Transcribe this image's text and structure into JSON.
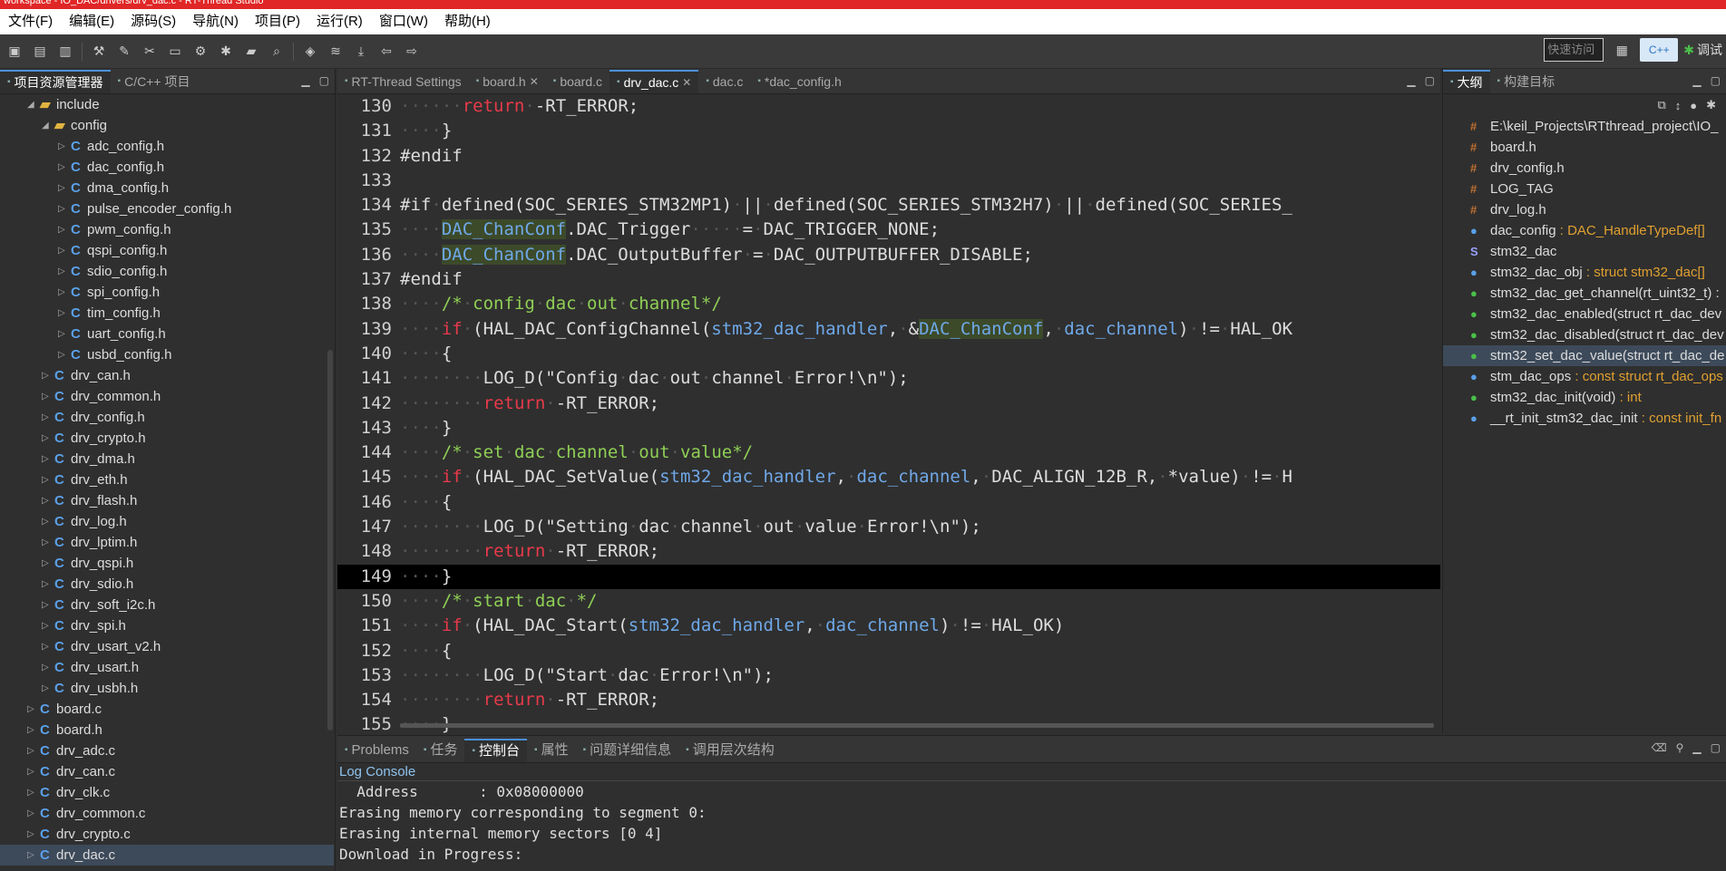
{
  "window": {
    "title": "workspace - IO_DAC/drivers/drv_dac.c - RT-Thread Studio"
  },
  "menu": [
    "文件(F)",
    "编辑(E)",
    "源码(S)",
    "导航(N)",
    "项目(P)",
    "运行(R)",
    "窗口(W)",
    "帮助(H)"
  ],
  "toolbar": {
    "quick_access": "快速访问",
    "perspective_c": "C++",
    "debug_label": "调试"
  },
  "project_panel": {
    "tabs": [
      {
        "label": "项目资源管理器",
        "active": true
      },
      {
        "label": "C/C++ 项目",
        "active": false
      }
    ],
    "tree": [
      {
        "label": "include",
        "kind": "folder",
        "depth": 2,
        "expanded": true
      },
      {
        "label": "config",
        "kind": "folder",
        "depth": 3,
        "expanded": true
      },
      {
        "label": "adc_config.h",
        "kind": "c",
        "depth": 4
      },
      {
        "label": "dac_config.h",
        "kind": "c",
        "depth": 4
      },
      {
        "label": "dma_config.h",
        "kind": "c",
        "depth": 4
      },
      {
        "label": "pulse_encoder_config.h",
        "kind": "c",
        "depth": 4
      },
      {
        "label": "pwm_config.h",
        "kind": "c",
        "depth": 4
      },
      {
        "label": "qspi_config.h",
        "kind": "c",
        "depth": 4
      },
      {
        "label": "sdio_config.h",
        "kind": "c",
        "depth": 4
      },
      {
        "label": "spi_config.h",
        "kind": "c",
        "depth": 4
      },
      {
        "label": "tim_config.h",
        "kind": "c",
        "depth": 4
      },
      {
        "label": "uart_config.h",
        "kind": "c",
        "depth": 4
      },
      {
        "label": "usbd_config.h",
        "kind": "c",
        "depth": 4
      },
      {
        "label": "drv_can.h",
        "kind": "c",
        "depth": 3
      },
      {
        "label": "drv_common.h",
        "kind": "c",
        "depth": 3
      },
      {
        "label": "drv_config.h",
        "kind": "c",
        "depth": 3
      },
      {
        "label": "drv_crypto.h",
        "kind": "c",
        "depth": 3
      },
      {
        "label": "drv_dma.h",
        "kind": "c",
        "depth": 3
      },
      {
        "label": "drv_eth.h",
        "kind": "c",
        "depth": 3
      },
      {
        "label": "drv_flash.h",
        "kind": "c",
        "depth": 3
      },
      {
        "label": "drv_log.h",
        "kind": "c",
        "depth": 3
      },
      {
        "label": "drv_lptim.h",
        "kind": "c",
        "depth": 3
      },
      {
        "label": "drv_qspi.h",
        "kind": "c",
        "depth": 3
      },
      {
        "label": "drv_sdio.h",
        "kind": "c",
        "depth": 3
      },
      {
        "label": "drv_soft_i2c.h",
        "kind": "c",
        "depth": 3
      },
      {
        "label": "drv_spi.h",
        "kind": "c",
        "depth": 3
      },
      {
        "label": "drv_usart_v2.h",
        "kind": "c",
        "depth": 3
      },
      {
        "label": "drv_usart.h",
        "kind": "c",
        "depth": 3
      },
      {
        "label": "drv_usbh.h",
        "kind": "c",
        "depth": 3
      },
      {
        "label": "board.c",
        "kind": "c",
        "depth": 2
      },
      {
        "label": "board.h",
        "kind": "c",
        "depth": 2
      },
      {
        "label": "drv_adc.c",
        "kind": "c",
        "depth": 2
      },
      {
        "label": "drv_can.c",
        "kind": "c",
        "depth": 2
      },
      {
        "label": "drv_clk.c",
        "kind": "c",
        "depth": 2
      },
      {
        "label": "drv_common.c",
        "kind": "c",
        "depth": 2
      },
      {
        "label": "drv_crypto.c",
        "kind": "c",
        "depth": 2
      },
      {
        "label": "drv_dac.c",
        "kind": "c",
        "depth": 2,
        "selected": true
      }
    ]
  },
  "editor": {
    "tabs": [
      {
        "label": "RT-Thread Settings",
        "active": false,
        "close": false
      },
      {
        "label": "board.h",
        "active": false,
        "close": true
      },
      {
        "label": "board.c",
        "active": false,
        "close": false
      },
      {
        "label": "drv_dac.c",
        "active": true,
        "close": true
      },
      {
        "label": "dac.c",
        "active": false,
        "close": false
      },
      {
        "label": "*dac_config.h",
        "active": false,
        "close": false
      }
    ],
    "lines": [
      {
        "n": "130",
        "text": "······return·-RT_ERROR;"
      },
      {
        "n": "131",
        "text": "····}"
      },
      {
        "n": "132",
        "text": "#endif"
      },
      {
        "n": "133",
        "text": ""
      },
      {
        "n": "134",
        "text": "#if·defined(SOC_SERIES_STM32MP1)·||·defined(SOC_SERIES_STM32H7)·||·defined(SOC_SERIES_"
      },
      {
        "n": "135",
        "text": "····DAC_ChanConf.DAC_Trigger·····=·DAC_TRIGGER_NONE;"
      },
      {
        "n": "136",
        "text": "····DAC_ChanConf.DAC_OutputBuffer·=·DAC_OUTPUTBUFFER_DISABLE;"
      },
      {
        "n": "137",
        "text": "#endif"
      },
      {
        "n": "138",
        "text": "····/*·config·dac·out·channel*/"
      },
      {
        "n": "139",
        "text": "····if·(HAL_DAC_ConfigChannel(stm32_dac_handler,·&DAC_ChanConf,·dac_channel)·!=·HAL_OK"
      },
      {
        "n": "140",
        "text": "····{"
      },
      {
        "n": "141",
        "text": "········LOG_D(\"Config·dac·out·channel·Error!\\n\");"
      },
      {
        "n": "142",
        "text": "········return·-RT_ERROR;"
      },
      {
        "n": "143",
        "text": "····}"
      },
      {
        "n": "144",
        "text": "····/*·set·dac·channel·out·value*/"
      },
      {
        "n": "145",
        "text": "····if·(HAL_DAC_SetValue(stm32_dac_handler,·dac_channel,·DAC_ALIGN_12B_R,·*value)·!=·H"
      },
      {
        "n": "146",
        "text": "····{"
      },
      {
        "n": "147",
        "text": "········LOG_D(\"Setting·dac·channel·out·value·Error!\\n\");"
      },
      {
        "n": "148",
        "text": "········return·-RT_ERROR;"
      },
      {
        "n": "149",
        "text": "····}",
        "highlight": true
      },
      {
        "n": "150",
        "text": "····/*·start·dac·*/"
      },
      {
        "n": "151",
        "text": "····if·(HAL_DAC_Start(stm32_dac_handler,·dac_channel)·!=·HAL_OK)"
      },
      {
        "n": "152",
        "text": "····{"
      },
      {
        "n": "153",
        "text": "········LOG_D(\"Start·dac·Error!\\n\");"
      },
      {
        "n": "154",
        "text": "········return·-RT_ERROR;"
      },
      {
        "n": "155",
        "text": "····}"
      }
    ]
  },
  "outline_panel": {
    "tabs": [
      {
        "label": "大纲",
        "active": true
      },
      {
        "label": "构建目标",
        "active": false
      }
    ],
    "items": [
      {
        "icon": "#",
        "kind": "hash",
        "label": "E:\\keil_Projects\\RTthread_project\\IO_",
        "type": ""
      },
      {
        "icon": "#",
        "kind": "hash",
        "label": "board.h",
        "type": ""
      },
      {
        "icon": "#",
        "kind": "hash",
        "label": "drv_config.h",
        "type": ""
      },
      {
        "icon": "#",
        "kind": "hash",
        "label": "LOG_TAG",
        "type": ""
      },
      {
        "icon": "#",
        "kind": "hash",
        "label": "drv_log.h",
        "type": ""
      },
      {
        "icon": "●",
        "kind": "dot",
        "label": "dac_config",
        "type": " : DAC_HandleTypeDef[]"
      },
      {
        "icon": "S",
        "kind": "s",
        "label": "stm32_dac",
        "type": ""
      },
      {
        "icon": "●",
        "kind": "dot",
        "label": "stm32_dac_obj",
        "type": " : struct stm32_dac[]"
      },
      {
        "icon": "●",
        "kind": "green",
        "label": "stm32_dac_get_channel(rt_uint32_t) :",
        "type": ""
      },
      {
        "icon": "●",
        "kind": "green",
        "label": "stm32_dac_enabled(struct rt_dac_dev",
        "type": ""
      },
      {
        "icon": "●",
        "kind": "green",
        "label": "stm32_dac_disabled(struct rt_dac_dev",
        "type": ""
      },
      {
        "icon": "●",
        "kind": "green",
        "label": "stm32_set_dac_value(struct rt_dac_de",
        "type": "",
        "selected": true
      },
      {
        "icon": "●",
        "kind": "dot",
        "label": "stm_dac_ops",
        "type": " : const struct rt_dac_ops"
      },
      {
        "icon": "●",
        "kind": "green",
        "label": "stm32_dac_init(void)",
        "type": " : int"
      },
      {
        "icon": "●",
        "kind": "dot",
        "label": "__rt_init_stm32_dac_init",
        "type": " : const init_fn"
      }
    ]
  },
  "console_panel": {
    "tabs": [
      {
        "label": "Problems",
        "active": false
      },
      {
        "label": "任务",
        "active": false
      },
      {
        "label": "控制台",
        "active": true
      },
      {
        "label": "属性",
        "active": false
      },
      {
        "label": "问题详细信息",
        "active": false
      },
      {
        "label": "调用层次结构",
        "active": false
      }
    ],
    "title": "Log Console",
    "lines": [
      "  Address       : 0x08000000",
      "Erasing memory corresponding to segment 0:",
      "Erasing internal memory sectors [0 4]",
      "Download in Progress:"
    ]
  }
}
